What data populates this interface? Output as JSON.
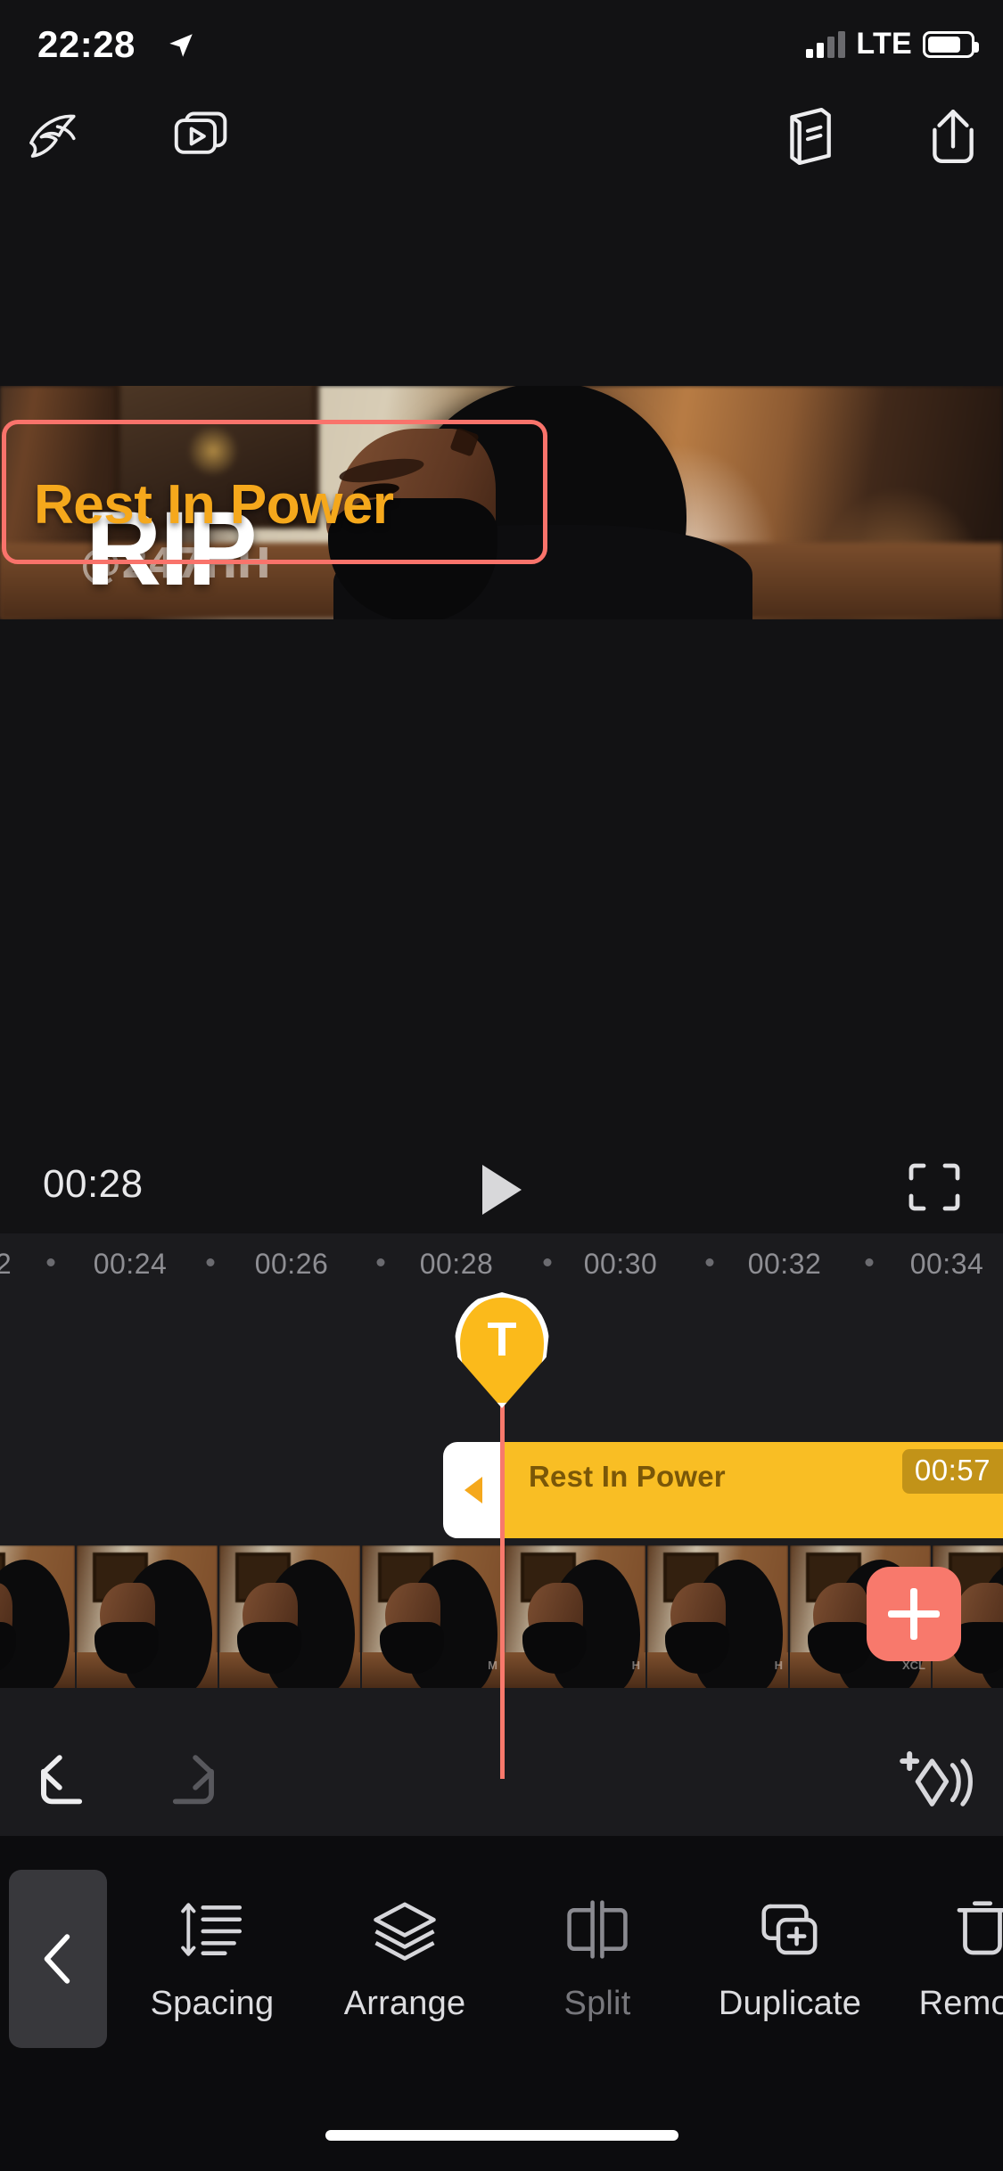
{
  "status_bar": {
    "time": "22:28",
    "location_icon": "location-arrow-icon",
    "network": "LTE",
    "signal_icon": "signal-bars-icon",
    "battery_icon": "battery-icon",
    "battery_level": 78
  },
  "top_toolbar": {
    "buttons": [
      {
        "name": "playback-speed-icon",
        "label": "Speed"
      },
      {
        "name": "clips-icon",
        "label": "Clips"
      },
      {
        "name": "tutorial-book-icon",
        "label": "Help"
      },
      {
        "name": "share-export-icon",
        "label": "Share"
      }
    ]
  },
  "preview": {
    "text_layers": [
      {
        "text": "RIP",
        "color": "#FFFFFF",
        "selected": false
      },
      {
        "text": "Rest In Power",
        "color": "#F5A81C",
        "selected": true
      }
    ],
    "selection_color": "#F9736B",
    "watermark": "@247HH"
  },
  "playback": {
    "current_time": "00:28",
    "play_icon": "play-icon",
    "fullscreen_icon": "fullscreen-icon"
  },
  "timeline": {
    "ruler_ticks": [
      "2",
      "00:24",
      "00:26",
      "00:28",
      "00:30",
      "00:32",
      "00:34"
    ],
    "playhead_color": "#F8796C",
    "pin": {
      "icon": "text-pin-icon",
      "glyph": "T",
      "color": "#FBBA1B"
    },
    "text_clip": {
      "label": "Rest In Power",
      "duration": "00:57",
      "color": "#F9BE24",
      "handle_icon": "trim-handle-left-icon"
    },
    "add_button": {
      "icon": "plus-icon",
      "color": "#F8796C"
    },
    "thumbnails": [
      {
        "mark": ""
      },
      {
        "mark": ""
      },
      {
        "mark": ""
      },
      {
        "mark": "M"
      },
      {
        "mark": "H"
      },
      {
        "mark": "H"
      },
      {
        "mark": "XCL"
      }
    ]
  },
  "edit_bar": {
    "undo": {
      "icon": "undo-icon",
      "enabled": true
    },
    "redo": {
      "icon": "redo-icon",
      "enabled": false
    },
    "keyframe": {
      "icon": "add-keyframe-icon",
      "enabled": true
    }
  },
  "bottom_toolbar": {
    "back": {
      "icon": "chevron-left-icon"
    },
    "tools": [
      {
        "label": "Spacing",
        "icon": "line-spacing-icon",
        "enabled": true
      },
      {
        "label": "Arrange",
        "icon": "layers-icon",
        "enabled": true
      },
      {
        "label": "Split",
        "icon": "split-icon",
        "enabled": false
      },
      {
        "label": "Duplicate",
        "icon": "duplicate-icon",
        "enabled": true
      },
      {
        "label": "Remove",
        "icon": "trash-icon",
        "enabled": true
      }
    ]
  }
}
